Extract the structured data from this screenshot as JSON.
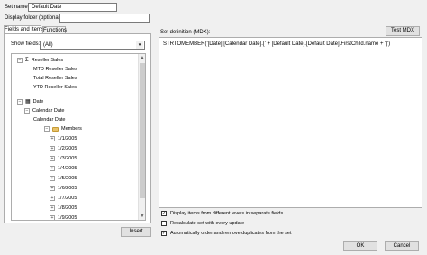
{
  "set_name": {
    "label": "Set name:",
    "value": "Default Date"
  },
  "display_folder": {
    "label": "Display folder (optional):",
    "value": ""
  },
  "tabs": [
    {
      "label": "Fields and Items",
      "active": true
    },
    {
      "label": "Functions",
      "active": false
    }
  ],
  "show_fields": {
    "label": "Show fields:",
    "selected": "(All)"
  },
  "tree": {
    "reseller_sales": "Reseller Sales",
    "mtd_reseller_sales": "MTD Reseller Sales",
    "total_reseller_sales": "Total Reseller Sales",
    "ytd_reseller_sales": "YTD Reseller Sales",
    "date": "Date",
    "calendar_date": "Calendar Date",
    "calendar_date_level": "Calendar Date",
    "members": "Members",
    "dates": [
      "1/1/2005",
      "1/2/2005",
      "1/3/2005",
      "1/4/2005",
      "1/5/2005",
      "1/6/2005",
      "1/7/2005",
      "1/8/2005",
      "1/9/2005"
    ]
  },
  "insert_button": "Insert",
  "set_definition": {
    "label": "Set definition (MDX):",
    "text": "STRTOMEMBER('[Date].[Calendar Date].[' + [Default Date].[Default Date].FirstChild.name + ']')"
  },
  "test_mdx_button": "Test MDX",
  "options": [
    {
      "label": "Display items from different levels in separate fields",
      "checked": true
    },
    {
      "label": "Recalculate set with every update",
      "checked": false
    },
    {
      "label": "Automatically order and remove duplicates from the set",
      "checked": true
    }
  ],
  "ok_button": "OK",
  "cancel_button": "Cancel",
  "colors": {
    "dialog_bg": "#f0f0f0",
    "border": "#adadad",
    "input_bg": "#ffffff"
  }
}
